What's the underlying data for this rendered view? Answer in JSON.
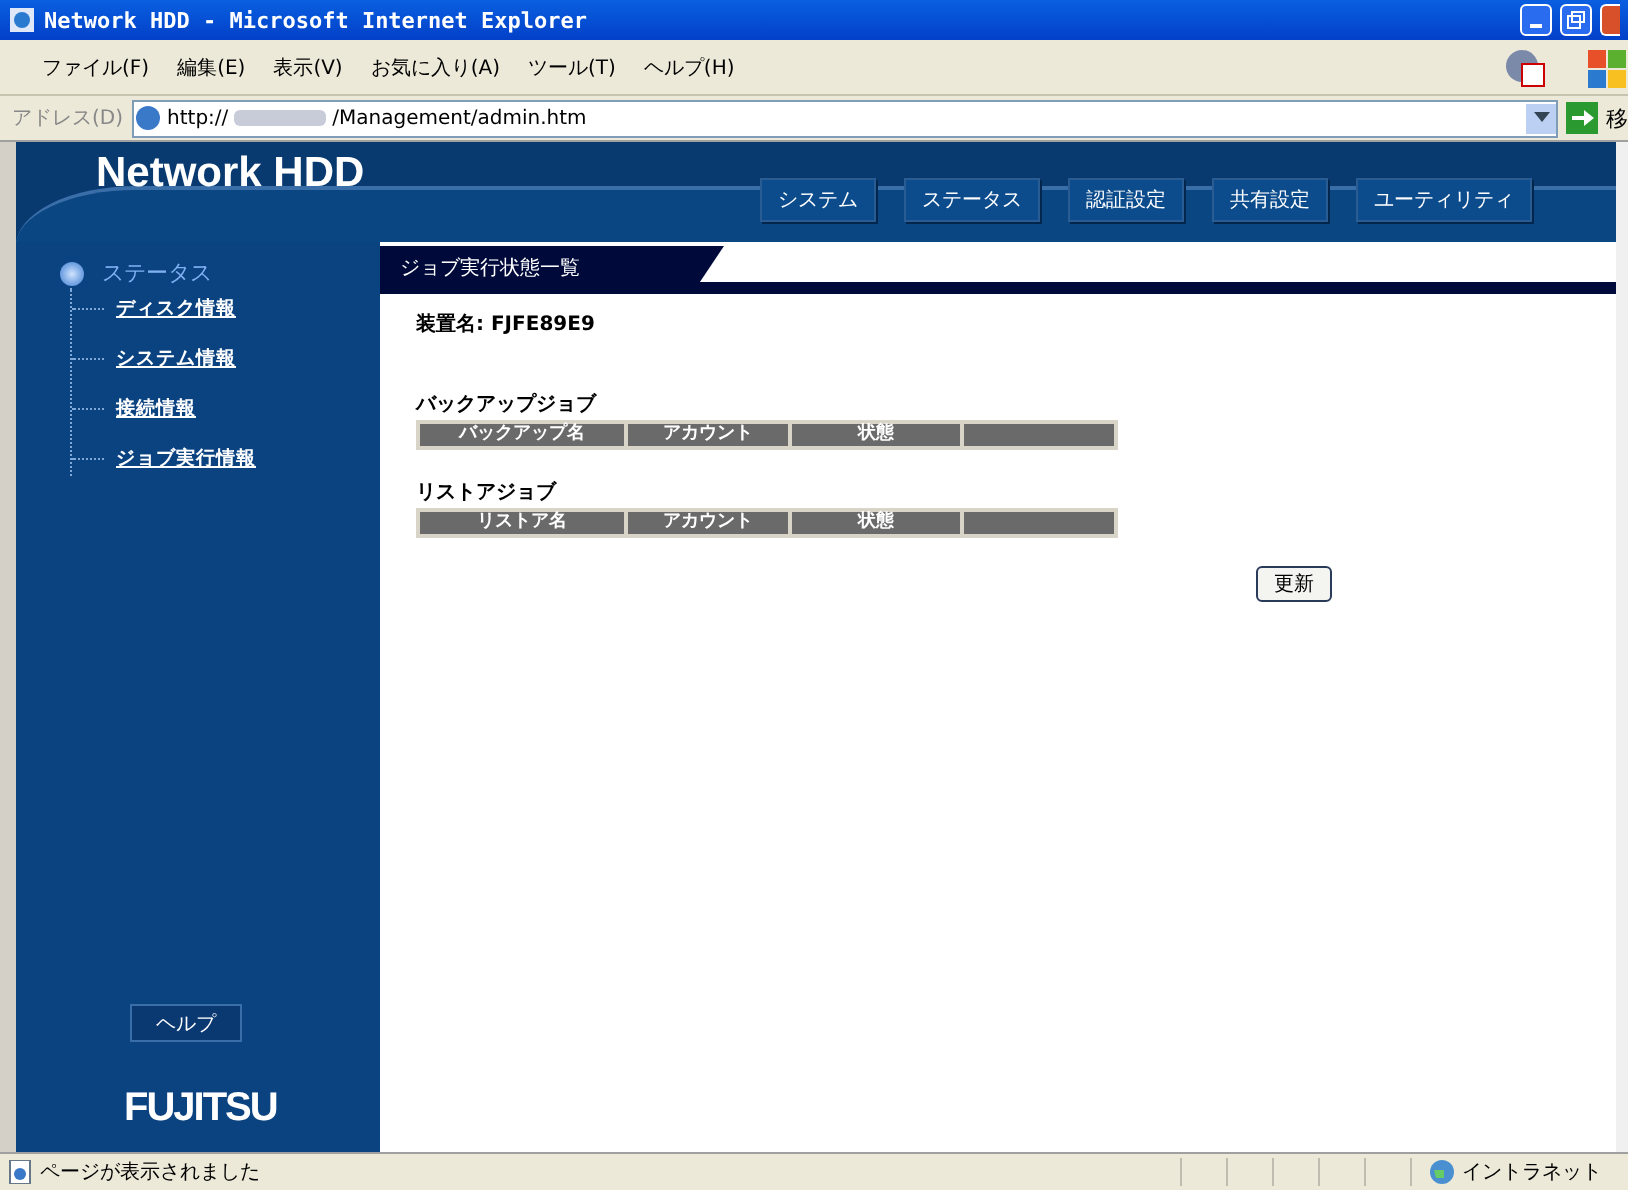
{
  "window": {
    "title": "Network HDD - Microsoft Internet Explorer"
  },
  "menu": [
    "ファイル(F)",
    "編集(E)",
    "表示(V)",
    "お気に入り(A)",
    "ツール(T)",
    "ヘルプ(H)"
  ],
  "address": {
    "label": "アドレス(D)",
    "url_start": "http://",
    "url_end": "/Management/admin.htm",
    "go": "移"
  },
  "header": {
    "logo": "Network HDD",
    "nav": [
      "システム",
      "ステータス",
      "認証設定",
      "共有設定",
      "ユーティリティ"
    ]
  },
  "sidebar": {
    "section": "ステータス",
    "links": [
      "ディスク情報",
      "システム情報",
      "接続情報",
      "ジョブ実行情報"
    ],
    "help": "ヘルプ",
    "brand": "FUJITSU"
  },
  "content": {
    "title": "ジョブ実行状態一覧",
    "device_label": "装置名:",
    "device_name": "FJFE89E9",
    "sections": [
      {
        "heading": "バックアップジョブ",
        "columns": [
          "バックアップ名",
          "アカウント",
          "状態"
        ]
      },
      {
        "heading": "リストアジョブ",
        "columns": [
          "リストア名",
          "アカウント",
          "状態"
        ]
      }
    ],
    "button": "更新"
  },
  "status_bar": {
    "text": "ページが表示されました",
    "zone": "イントラネット"
  }
}
